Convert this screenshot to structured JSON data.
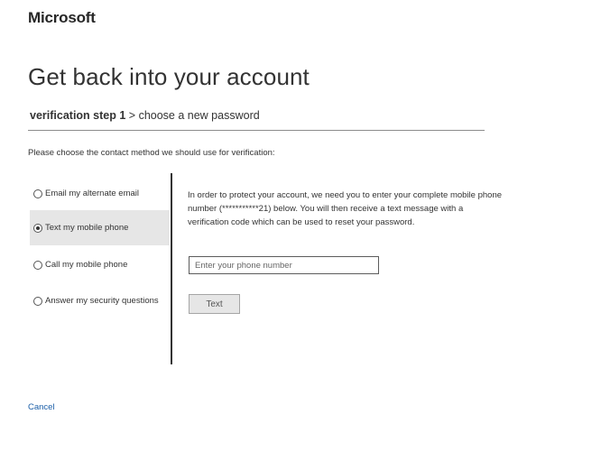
{
  "brand": {
    "logo_text": "Microsoft"
  },
  "page": {
    "title": "Get back into your account"
  },
  "breadcrumb": {
    "current_step": "verification step 1",
    "separator": ">",
    "next_step": "choose a new password"
  },
  "instruction": "Please choose the contact method we should use for verification:",
  "contact_methods": [
    {
      "label": "Email my alternate email",
      "selected": false
    },
    {
      "label": "Text my mobile phone",
      "selected": true
    },
    {
      "label": "Call my mobile phone",
      "selected": false
    },
    {
      "label": "Answer my security questions",
      "selected": false
    }
  ],
  "panel": {
    "description": "In order to protect your account, we need you to enter your complete mobile phone number (***********21) below. You will then receive a text message with a verification code which can be used to reset your password.",
    "phone_placeholder": "Enter your phone number",
    "phone_value": "",
    "submit_label": "Text"
  },
  "footer": {
    "cancel_label": "Cancel"
  },
  "colors": {
    "link": "#1a5ea8",
    "selected_background": "#e6e6e6",
    "divider": "#333333"
  }
}
